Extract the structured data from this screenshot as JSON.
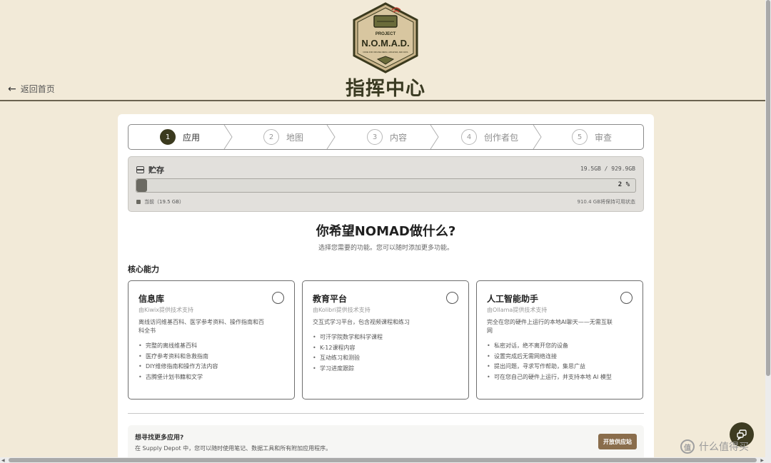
{
  "header": {
    "logo": {
      "line1": "PROJECT",
      "line2": "N.O.M.A.D.",
      "tagline": "NODE FOR OFFLINE MEDIA, ARCHIVES, AND DATA"
    },
    "title": "指挥中心",
    "back_label": "返回首页"
  },
  "stepper": [
    {
      "num": "1",
      "label": "应用",
      "active": true
    },
    {
      "num": "2",
      "label": "地图",
      "active": false
    },
    {
      "num": "3",
      "label": "内容",
      "active": false
    },
    {
      "num": "4",
      "label": "创作者包",
      "active": false
    },
    {
      "num": "5",
      "label": "审查",
      "active": false
    }
  ],
  "storage": {
    "label": "贮存",
    "size_text": "19.5GB / 929.9GB",
    "percent": 2,
    "percent_text": "2 %",
    "legend_current": "当前（19.5 GB）",
    "free_text": "910.4 GB将保持可用状态"
  },
  "question": {
    "title": "你希望NOMAD做什么?",
    "subtitle": "选择您需要的功能。您可以随时添加更多功能。"
  },
  "section_title": "核心能力",
  "features": [
    {
      "title": "信息库",
      "subtitle": "由Kiwix提供技术支持",
      "desc": "离线访问维基百科、医学参考资料、操作指南和百科全书",
      "items": [
        "完整的离线维基百科",
        "医疗参考资料和急救指南",
        "DIY维修指南和操作方法内容",
        "古腾堡计划书籍和文学"
      ]
    },
    {
      "title": "教育平台",
      "subtitle": "由Kolibri提供技术支持",
      "desc": "交互式学习平台，包含视频课程和练习",
      "items": [
        "可汗学院数学和科学课程",
        "K-12课程内容",
        "互动练习和测验",
        "学习进度跟踪"
      ]
    },
    {
      "title": "人工智能助手",
      "subtitle": "由Ollama提供技术支持",
      "desc": "完全在您的硬件上运行的本地AI聊天——无需互联网",
      "items": [
        "私密对话，绝不离开您的设备",
        "设置完成后无需网络连接",
        "提出问题，寻求写作帮助，集思广益",
        "可在您自己的硬件上运行，并支持本地 AI 模型"
      ]
    }
  ],
  "more": {
    "title": "想寻找更多应用?",
    "desc": "在 Supply Depot 中，您可以随时使用笔记、数据工具和所有附加应用程序。",
    "button": "开放供应站"
  },
  "watermark": "什么值得买",
  "colors": {
    "background": "#f2ead8",
    "accent_dark": "#3b3a1e",
    "button_brown": "#8a6d4c"
  }
}
